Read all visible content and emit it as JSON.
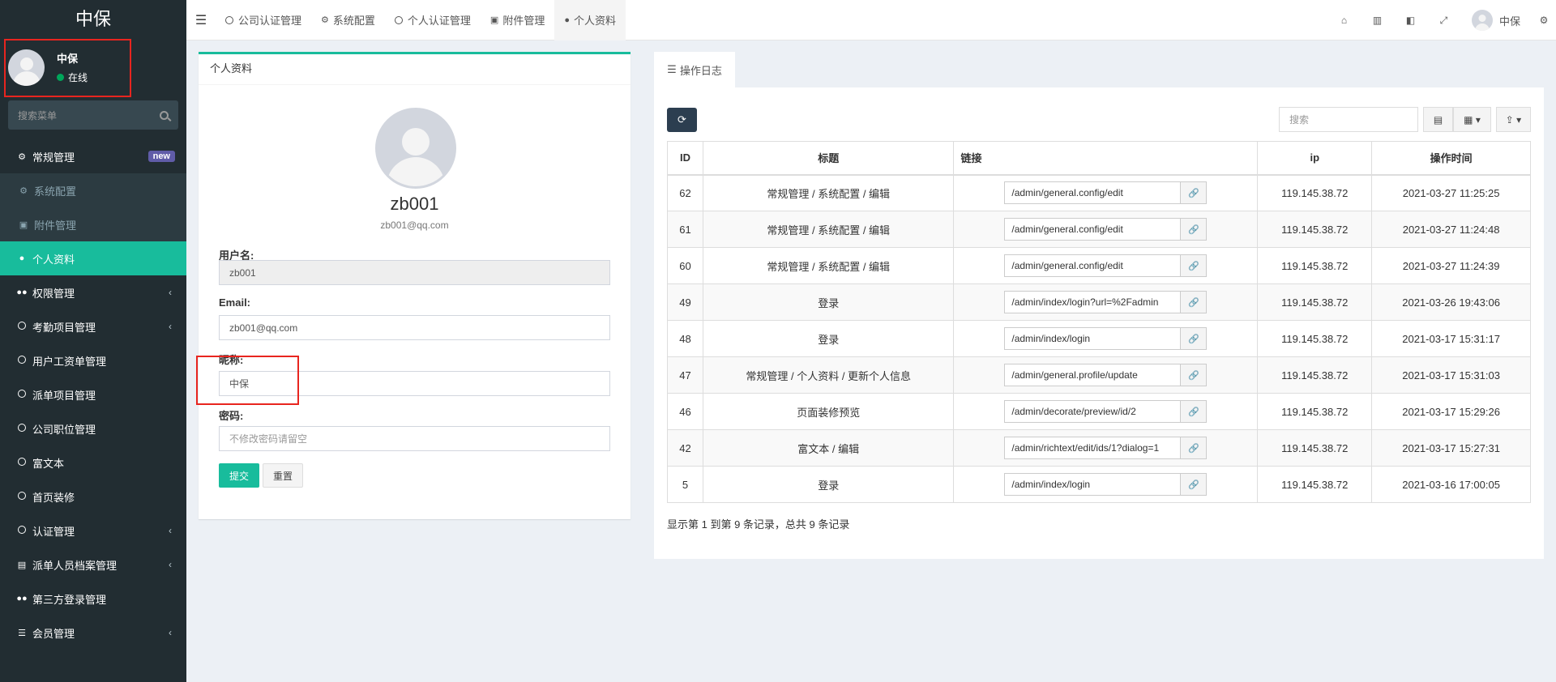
{
  "brand": "中保",
  "user": {
    "name": "中保",
    "status": "在线"
  },
  "sidebar": {
    "search_placeholder": "搜索菜单",
    "items": [
      {
        "label": "常规管理",
        "icon": "cogs-icon",
        "badge": "new"
      },
      {
        "label": "系统配置",
        "icon": "gear-icon"
      },
      {
        "label": "附件管理",
        "icon": "file-image-icon"
      },
      {
        "label": "个人资料",
        "icon": "user-icon"
      },
      {
        "label": "权限管理",
        "icon": "group-icon"
      },
      {
        "label": "考勤项目管理",
        "icon": "circle-o-icon"
      },
      {
        "label": "用户工资单管理",
        "icon": "circle-o-icon"
      },
      {
        "label": "派单项目管理",
        "icon": "circle-o-icon"
      },
      {
        "label": "公司职位管理",
        "icon": "circle-o-icon"
      },
      {
        "label": "富文本",
        "icon": "circle-o-icon"
      },
      {
        "label": "首页装修",
        "icon": "circle-o-icon"
      },
      {
        "label": "认证管理",
        "icon": "circle-o-icon"
      },
      {
        "label": "派单人员档案管理",
        "icon": "address-book-icon"
      },
      {
        "label": "第三方登录管理",
        "icon": "users-icon"
      },
      {
        "label": "会员管理",
        "icon": "list-icon"
      }
    ]
  },
  "tabs": [
    {
      "label": "公司认证管理"
    },
    {
      "label": "系统配置"
    },
    {
      "label": "个人认证管理"
    },
    {
      "label": "附件管理"
    },
    {
      "label": "个人资料"
    }
  ],
  "topbar": {
    "username": "中保"
  },
  "profile": {
    "panel_title": "个人资料",
    "username_display": "zb001",
    "email_display": "zb001@qq.com",
    "username_label": "用户名:",
    "username_value": "zb001",
    "email_label": "Email:",
    "email_value": "zb001@qq.com",
    "nickname_label": "昵称:",
    "nickname_value": "中保",
    "password_label": "密码:",
    "password_placeholder": "不修改密码请留空",
    "submit_label": "提交",
    "reset_label": "重置"
  },
  "log": {
    "tab_label": "操作日志",
    "search_placeholder": "搜索",
    "columns": [
      "ID",
      "标题",
      "链接",
      "ip",
      "操作时间"
    ],
    "rows": [
      {
        "id": "62",
        "title": "常规管理 / 系统配置 / 编辑",
        "url": "/admin/general.config/edit",
        "ip": "119.145.38.72",
        "time": "2021-03-27 11:25:25"
      },
      {
        "id": "61",
        "title": "常规管理 / 系统配置 / 编辑",
        "url": "/admin/general.config/edit",
        "ip": "119.145.38.72",
        "time": "2021-03-27 11:24:48"
      },
      {
        "id": "60",
        "title": "常规管理 / 系统配置 / 编辑",
        "url": "/admin/general.config/edit",
        "ip": "119.145.38.72",
        "time": "2021-03-27 11:24:39"
      },
      {
        "id": "49",
        "title": "登录",
        "url": "/admin/index/login?url=%2Fadmin",
        "ip": "119.145.38.72",
        "time": "2021-03-26 19:43:06"
      },
      {
        "id": "48",
        "title": "登录",
        "url": "/admin/index/login",
        "ip": "119.145.38.72",
        "time": "2021-03-17 15:31:17"
      },
      {
        "id": "47",
        "title": "常规管理 / 个人资料 / 更新个人信息",
        "url": "/admin/general.profile/update",
        "ip": "119.145.38.72",
        "time": "2021-03-17 15:31:03"
      },
      {
        "id": "46",
        "title": "页面装修预览",
        "url": "/admin/decorate/preview/id/2",
        "ip": "119.145.38.72",
        "time": "2021-03-17 15:29:26"
      },
      {
        "id": "42",
        "title": "富文本 / 编辑",
        "url": "/admin/richtext/edit/ids/1?dialog=1",
        "ip": "119.145.38.72",
        "time": "2021-03-17 15:27:31"
      },
      {
        "id": "5",
        "title": "登录",
        "url": "/admin/index/login",
        "ip": "119.145.38.72",
        "time": "2021-03-16 17:00:05"
      }
    ],
    "footer": "显示第 1 到第 9 条记录，总共 9 条记录"
  },
  "colors": {
    "accent": "#18bc9c",
    "sidebar_bg": "#222d32",
    "highlight_box": "#e8251f"
  }
}
